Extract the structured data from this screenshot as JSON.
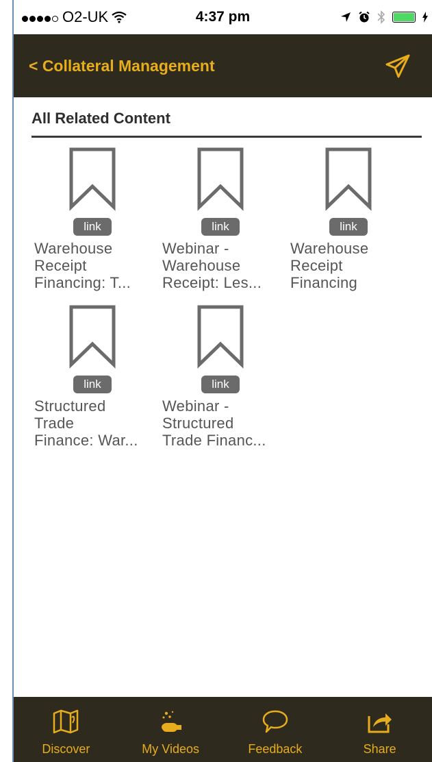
{
  "status_bar": {
    "carrier": "O2-UK",
    "time": "4:37 pm"
  },
  "nav": {
    "back_label": "< Collateral Management"
  },
  "section": {
    "title": "All Related Content"
  },
  "items": [
    {
      "badge": "link",
      "title": "Warehouse\nReceipt\nFinancing: T..."
    },
    {
      "badge": "link",
      "title": "Webinar -\nWarehouse\nReceipt: Les..."
    },
    {
      "badge": "link",
      "title": "Warehouse\nReceipt\nFinancing"
    },
    {
      "badge": "link",
      "title": "Structured\nTrade\nFinance: War..."
    },
    {
      "badge": "link",
      "title": "Webinar -\nStructured\nTrade Financ..."
    }
  ],
  "tabs": [
    {
      "label": "Discover",
      "icon": "map-icon"
    },
    {
      "label": "My Videos",
      "icon": "videos-icon"
    },
    {
      "label": "Feedback",
      "icon": "speech-bubble-icon"
    },
    {
      "label": "Share",
      "icon": "share-icon"
    }
  ],
  "colors": {
    "bar_background": "#2e2a1d",
    "accent": "#e7ad1d",
    "battery": "#4cd964"
  }
}
